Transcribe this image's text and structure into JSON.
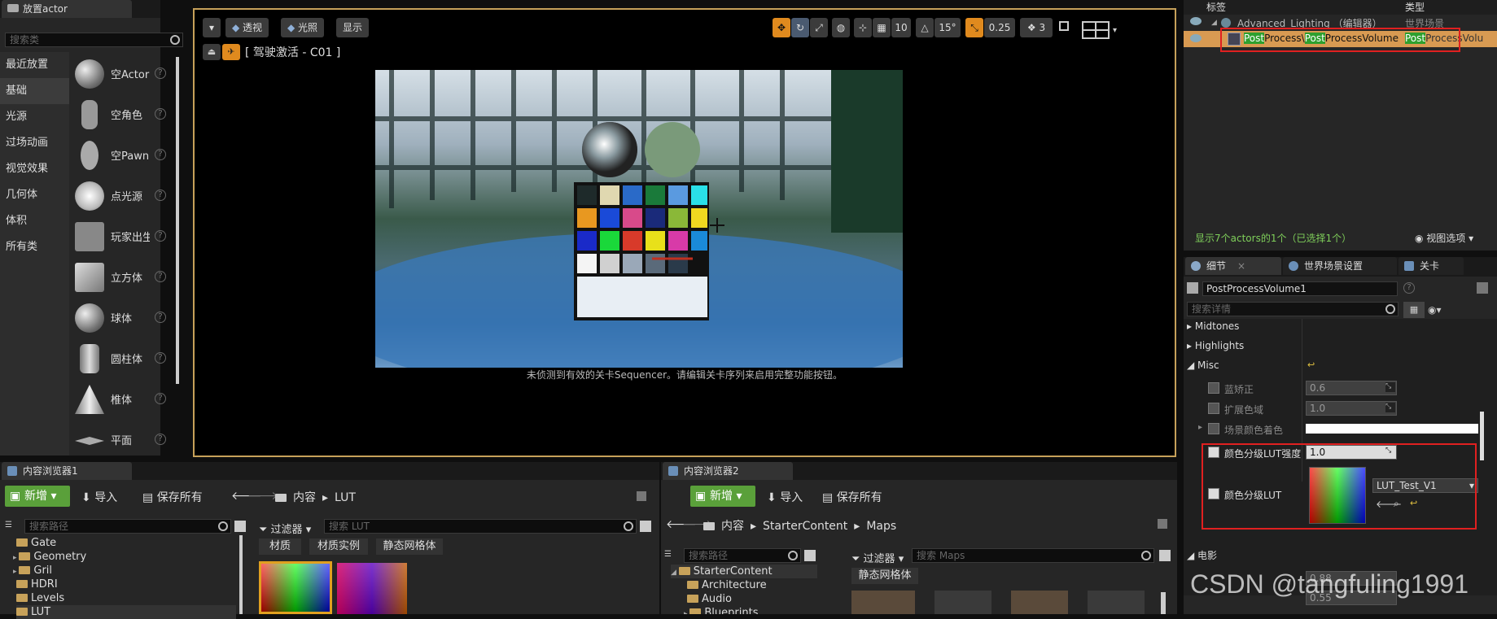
{
  "place_actor": {
    "tab_title": "放置actor",
    "search_placeholder": "搜索类",
    "categories": [
      "最近放置",
      "基础",
      "光源",
      "过场动画",
      "视觉效果",
      "几何体",
      "体积",
      "所有类"
    ],
    "items": [
      "空Actor",
      "空角色",
      "空Pawn",
      "点光源",
      "玩家出生",
      "立方体",
      "球体",
      "圆柱体",
      "椎体",
      "平面"
    ]
  },
  "viewport": {
    "btn_perspective": "透视",
    "btn_lit": "光照",
    "btn_show": "显示",
    "pilot_label": "[ 驾驶激活 - C01 ]",
    "grid_snap": "10",
    "rot_snap": "15°",
    "scale_snap": "0.25",
    "cam_speed": "3",
    "message": "未侦测到有效的关卡Sequencer。请编辑关卡序列来启用完整功能按钮。"
  },
  "outliner": {
    "col_label": "标签",
    "col_type": "类型",
    "row1_name": "Advanced_Lighting （编辑器）",
    "row1_type": "世界场景",
    "row2_name": "PostProcessVolume",
    "row2_hl1": "Post",
    "row2_mid1": "Process\\",
    "row2_hl2": "Post",
    "row2_mid2": "ProcessVolume",
    "row2_hl3": "Post",
    "row2_type": "ProcessVolu",
    "status": "显示7个actors的1个（已选择1个）",
    "view_options": "视图选项"
  },
  "details": {
    "tab_details": "细节",
    "tab_world": "世界场景设置",
    "tab_level": "关卡",
    "actor_name": "PostProcessVolume1",
    "search_placeholder": "搜索详情",
    "sections": [
      "Midtones",
      "Highlights",
      "Misc"
    ],
    "blue_correction_label": "蓝矫正",
    "blue_correction_value": "0.6",
    "expand_gamut_label": "扩展色域",
    "expand_gamut_value": "1.0",
    "scene_tint_label": "场景颜色着色",
    "lut_intensity_label": "颜色分级LUT强度",
    "lut_intensity_value": "1.0",
    "lut_label": "颜色分级LUT",
    "lut_asset": "LUT_Test_V1",
    "film_section": "电影",
    "film_value1": "0.88",
    "film_value2": "0.55"
  },
  "cb1": {
    "tab_title": "内容浏览器1",
    "add_new": "新增",
    "import": "导入",
    "save_all": "保存所有",
    "path_root": "内容",
    "path_leaf": "LUT",
    "search_paths": "搜索路径",
    "filters": "过滤器",
    "search_assets": "搜索 LUT",
    "filter_chips": [
      "材质",
      "材质实例",
      "静态网格体"
    ],
    "folders": [
      "Gate",
      "Geometry",
      "Gril",
      "HDRI",
      "Levels",
      "LUT"
    ]
  },
  "cb2": {
    "tab_title": "内容浏览器2",
    "add_new": "新增",
    "import": "导入",
    "save_all": "保存所有",
    "path_root": "内容",
    "path_mid": "StarterContent",
    "path_leaf": "Maps",
    "search_paths": "搜索路径",
    "filters": "过滤器",
    "search_assets": "搜索 Maps",
    "filter_chips": [
      "静态网格体"
    ],
    "folders": [
      "StarterContent",
      "Architecture",
      "Audio",
      "Blueprints"
    ]
  },
  "watermark": "CSDN @tangfuling1991",
  "colors": {
    "accent_orange": "#e08a1e",
    "select_green": "#5aa03a",
    "highlight_red": "#e02020",
    "outline_blue": "#c6a15a"
  }
}
